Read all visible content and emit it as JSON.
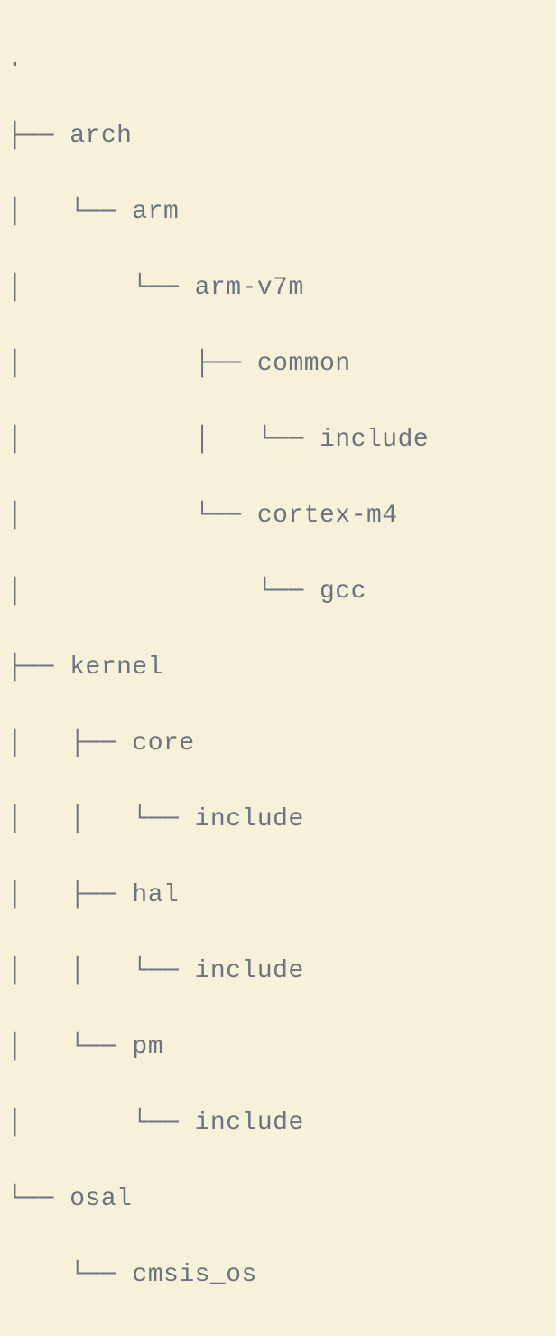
{
  "tree": {
    "root": ".",
    "lines": [
      ".",
      "├── arch",
      "│   └── arm",
      "│       └── arm-v7m",
      "│           ├── common",
      "│           │   └── include",
      "│           └── cortex-m4",
      "│               └── gcc",
      "├── kernel",
      "│   ├── core",
      "│   │   └── include",
      "│   ├── hal",
      "│   │   └── include",
      "│   └── pm",
      "│       └── include",
      "└── osal",
      "    └── cmsis_os"
    ]
  }
}
